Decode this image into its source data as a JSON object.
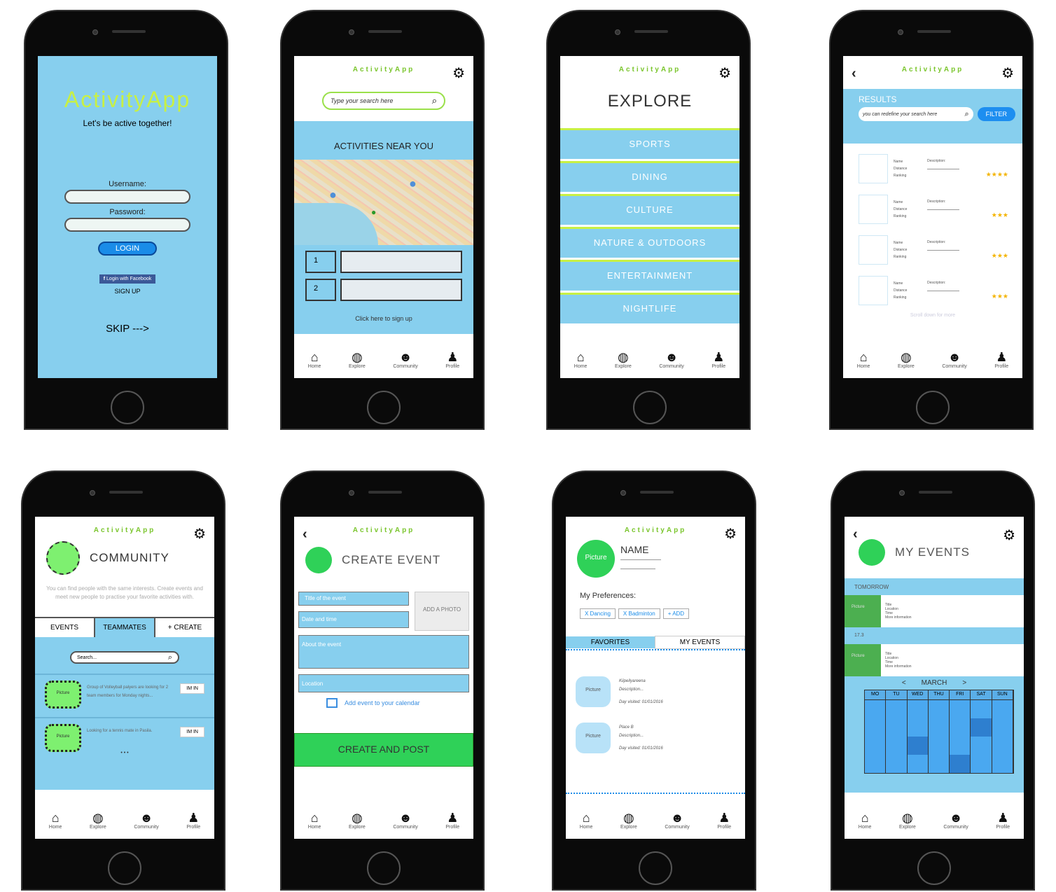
{
  "app": "ActivityApp",
  "nav": [
    "Home",
    "Explore",
    "Community",
    "Profile"
  ],
  "icons": {
    "home": "home-icon",
    "explore": "globe-icon",
    "community": "people-icon",
    "profile": "person-icon",
    "gear": "gear-icon",
    "back": "back-chevron-icon",
    "search": "search-icon"
  },
  "login": {
    "title": "ActivityApp",
    "tagline": "Let's be active together!",
    "username": "Username:",
    "password": "Password:",
    "login": "LOGIN",
    "facebook": "Login with Facebook",
    "signup": "SIGN UP",
    "skip": "SKIP --->"
  },
  "home": {
    "search_placeholder": "Type your search here",
    "heading": "ACTIVITIES NEAR YOU",
    "items": [
      "1",
      "2"
    ],
    "signup_link": "Click here to sign up"
  },
  "explore": {
    "heading": "EXPLORE",
    "categories": [
      "SPORTS",
      "DINING",
      "CULTURE",
      "NATURE & OUTDOORS",
      "ENTERTAINMENT",
      "NIGHTLIFE"
    ]
  },
  "results": {
    "heading": "RESULTS",
    "search_placeholder": "you can redefine your search here",
    "filter": "FILTER",
    "name": "Name",
    "distance": "Distance",
    "ranking": "Ranking",
    "description": "Description:",
    "stars": [
      "★★★★",
      "★★★",
      "★★★",
      "★★★"
    ],
    "scroll": "Scroll down for more"
  },
  "community": {
    "heading": "COMMUNITY",
    "desc": "You can find people with the same interests. Create events and meet new people to practise your favorite activities with.",
    "tabs": [
      "EVENTS",
      "TEAMMATES",
      "+ CREATE"
    ],
    "search": "Search...",
    "picture": "Picture",
    "posts": [
      {
        "text": "Group of Volleyball palyers are looking for 2 team members for Monday nights...",
        "btn": "IM IN"
      },
      {
        "text": "Looking for a tennis mate in Pasila.",
        "btn": "IM IN"
      }
    ],
    "more": "• • •"
  },
  "create": {
    "heading": "CREATE EVENT",
    "title_field": "Title of the event",
    "date_field": "Date and time",
    "photo": "ADD A PHOTO",
    "about": "About the event",
    "location": "Location",
    "calendar": "Add event to your calendar",
    "post": "CREATE AND POST"
  },
  "profile": {
    "picture": "Picture",
    "name": "NAME",
    "prefs": "My Preferences:",
    "tags": [
      "X  Dancing",
      "X  Badminton",
      "+ ADD"
    ],
    "tabs": [
      "FAVORITES",
      "MY EVENTS"
    ],
    "favs": [
      {
        "name": "Kiipeilyareena",
        "desc": "Description...",
        "visited": "Day visited: 01/01/2016"
      },
      {
        "name": "Place B",
        "desc": "Description...",
        "visited": "Day visited: 01/01/2016"
      }
    ]
  },
  "myevents": {
    "heading": "MY EVENTS",
    "tomorrow": "TOMORROW",
    "date2": "17.3",
    "picture": "Picture",
    "details": [
      "Title",
      "Location",
      "Time",
      "More information"
    ],
    "month": "MARCH",
    "prev": "<",
    "next": ">",
    "days": [
      "MO",
      "TU",
      "WED",
      "THU",
      "FRI",
      "SAT",
      "SUN"
    ]
  }
}
